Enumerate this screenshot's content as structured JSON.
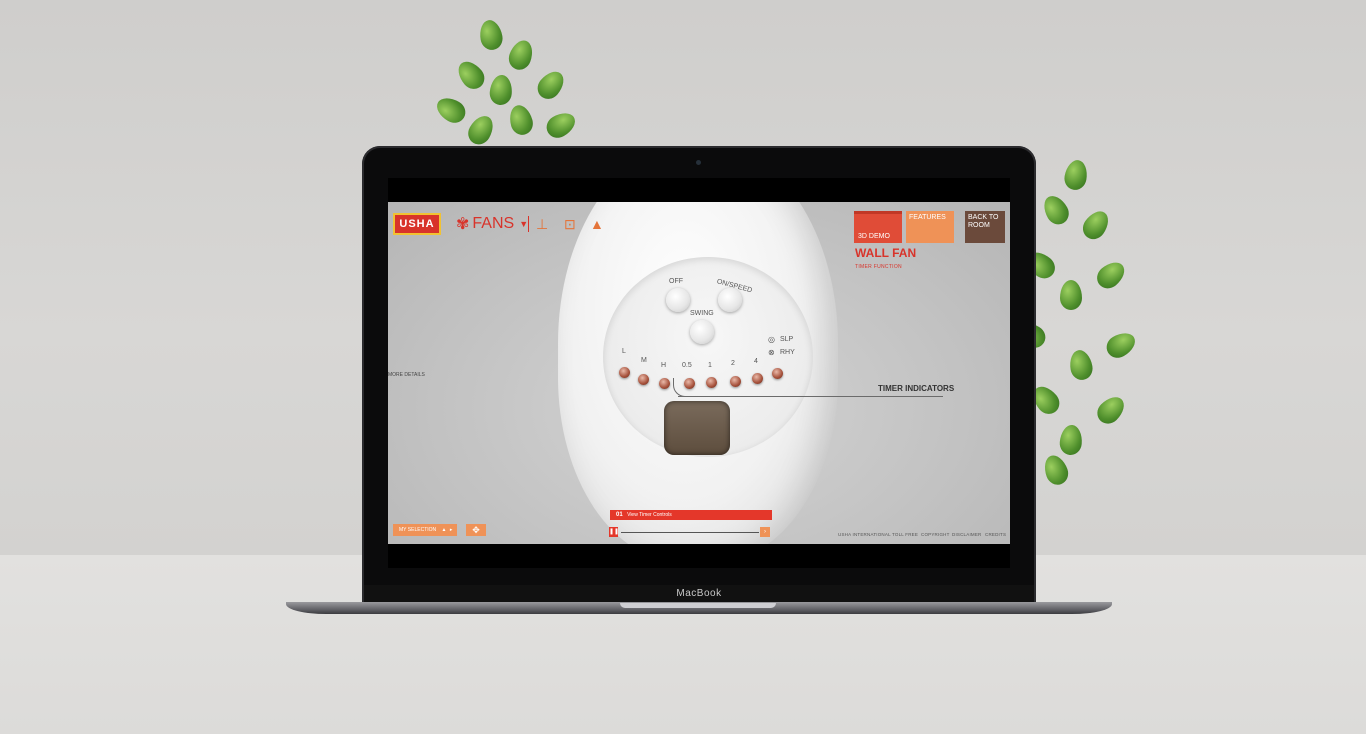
{
  "laptop": {
    "brand_label": "MacBook"
  },
  "app": {
    "logo": "USHA",
    "category": "FANS",
    "tabs": {
      "demo": "3D DEMO",
      "features": "FEATURES",
      "back": "BACK TO ROOM"
    },
    "title": "WALL FAN",
    "subtitle": "TIMER FUNCTION",
    "more_details": "MORE DETAILS",
    "timer_indicators": "TIMER INDICATORS",
    "panel": {
      "off": "OFF",
      "on_speed": "ON/SPEED",
      "swing": "SWING",
      "slp": "SLP",
      "rhy": "RHY",
      "speed_labels": [
        "L",
        "M",
        "H"
      ],
      "timer_labels": [
        "0.5",
        "1",
        "2",
        "4"
      ]
    },
    "selection_label": "MY SELECTION",
    "step": {
      "number": "01",
      "label": "View Timer Controls"
    },
    "footer": [
      "USHA INTERNATIONAL",
      "TOLL FREE",
      "COPYRIGHT",
      "DISCLAIMER",
      "CREDITS"
    ]
  },
  "colors": {
    "brand_red": "#d8332a",
    "accent_orange": "#ef9257",
    "dark_brown": "#6b4a3b",
    "logo_yellow": "#f1c232"
  },
  "icons": [
    "fan-icon",
    "ceiling-fan-icon",
    "table-fan-icon",
    "pedestal-fan-icon",
    "fullscreen-icon",
    "pause-icon",
    "next-icon"
  ]
}
